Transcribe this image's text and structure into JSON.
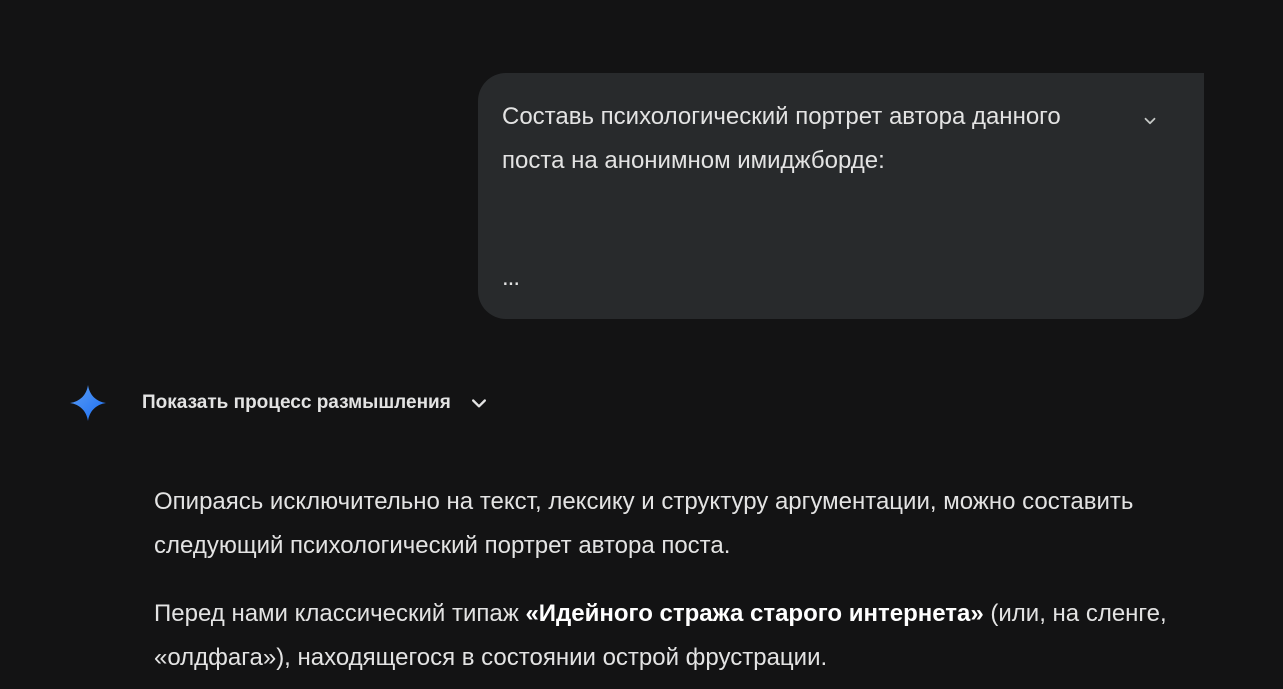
{
  "user_message": {
    "text": "Составь психологический портрет автора данного поста на анонимном имиджборде:",
    "ellipsis": "..."
  },
  "response": {
    "thinking_label": "Показать процесс размышления",
    "paragraph_1": "Опираясь исключительно на текст, лексику и структуру аргументации, можно составить следующий психологический портрет автора поста.",
    "paragraph_2_prefix": "Перед нами классический типаж ",
    "paragraph_2_bold": "«Идейного стража старого интернета»",
    "paragraph_2_suffix": " (или, на сленге, «олдфага»), находящегося в состоянии острой фрустрации."
  },
  "icons": {
    "expand": "chevron-down-icon",
    "logo": "gemini-sparkle-icon",
    "thinking_toggle": "chevron-down-icon"
  },
  "colors": {
    "background": "#131314",
    "bubble": "#282a2c",
    "text": "#e3e3e3",
    "logo_gradient_start": "#4796e3",
    "logo_gradient_end": "#1b6ef3"
  }
}
